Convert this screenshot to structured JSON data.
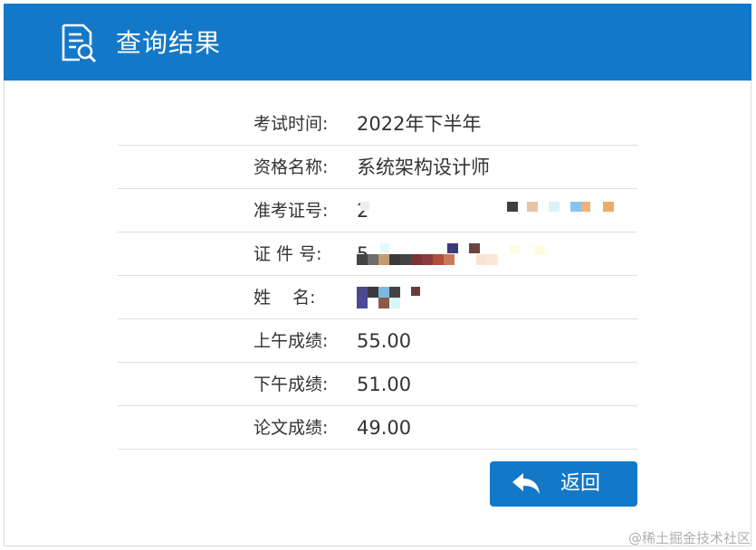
{
  "header": {
    "title": "查询结果"
  },
  "results": [
    {
      "label": "考试时间:",
      "value": "2022年下半年"
    },
    {
      "label": "资格名称:",
      "value": "系统架构设计师"
    },
    {
      "label": "准考证号:",
      "value": "2"
    },
    {
      "label": "证 件 号:",
      "value": "5"
    },
    {
      "label": "姓    名:",
      "value": ""
    },
    {
      "label": "上午成绩:",
      "value": "55.00"
    },
    {
      "label": "下午成绩:",
      "value": "51.00"
    },
    {
      "label": "论文成绩:",
      "value": "49.00"
    }
  ],
  "actions": {
    "back_label": "返回"
  },
  "watermark": "@稀土掘金技术社区",
  "colors": {
    "primary": "#1478c8",
    "text": "#333333",
    "divider": "#dedede"
  }
}
